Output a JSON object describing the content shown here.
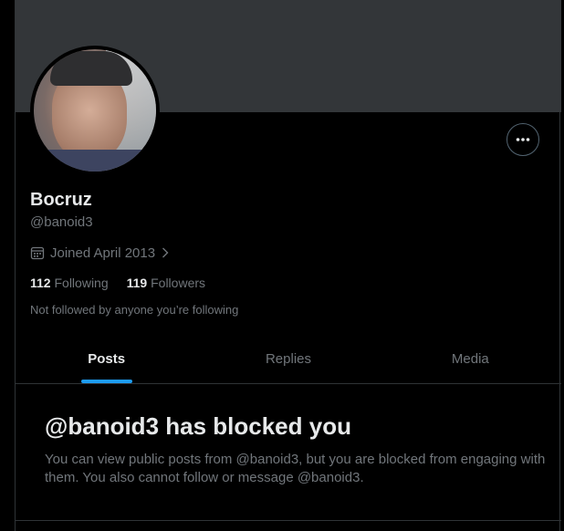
{
  "profile": {
    "name": "Bocruz",
    "handle": "@banoid3",
    "joined": "Joined April 2013",
    "following_count": "112",
    "following_label": "Following",
    "followers_count": "119",
    "followers_label": "Followers",
    "not_followed": "Not followed by anyone you’re following"
  },
  "tabs": [
    {
      "label": "Posts",
      "active": true
    },
    {
      "label": "Replies",
      "active": false
    },
    {
      "label": "Media",
      "active": false
    }
  ],
  "blocked": {
    "title": "@banoid3 has blocked you",
    "message": "You can view public posts from @banoid3, but you are blocked from engaging with them. You also cannot follow or message @banoid3."
  },
  "icons": {
    "more": "more-horizontal-icon",
    "calendar": "calendar-icon",
    "chevron": "chevron-right-icon"
  },
  "colors": {
    "background": "#000000",
    "banner": "#333639",
    "text_primary": "#e7e9ea",
    "text_secondary": "#71767b",
    "accent": "#1d9bf0",
    "border": "#2f3336"
  }
}
